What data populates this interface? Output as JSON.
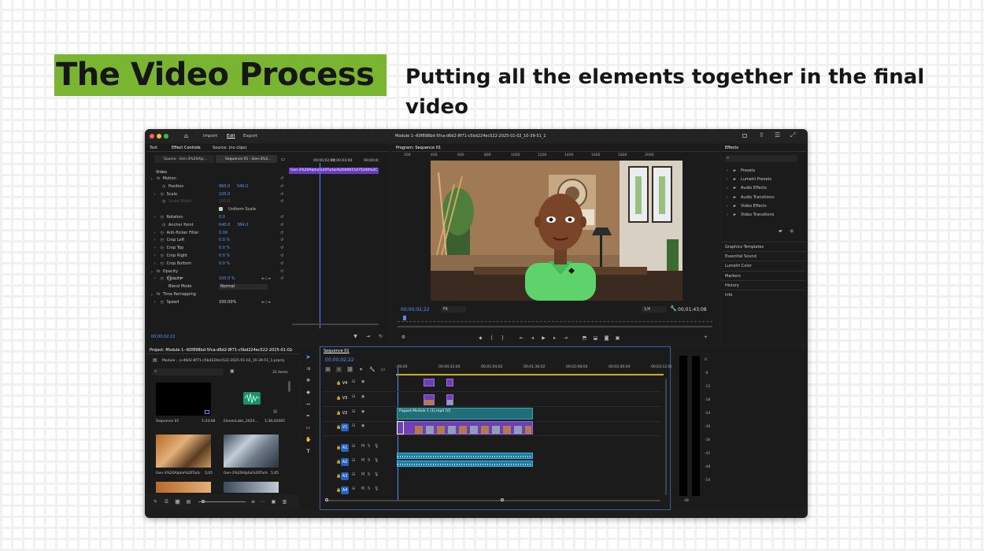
{
  "slide": {
    "title": "The Video Process",
    "subtitle": "Putting all the elements together in the final video",
    "accent_color": "#7ab532"
  },
  "app": {
    "top_tabs": [
      "Import",
      "Edit",
      "Export"
    ],
    "active_tab": "Edit",
    "window_title": "Module 1--60f898bd-5fca-d6d2-8f71-c5bd224ec522-2025-01-02_10-39-51_1"
  },
  "effect_controls": {
    "tabs": [
      "Text",
      "Effect Controls",
      "Source: (no clips)"
    ],
    "source_label": "Source · Gen-3%20Alp...",
    "sequence_label": "Sequence 01 · Gen-3%2...",
    "clip_name": "Gen-3%20Alpha%20Turbo%2040015475240%2C",
    "tc_ruler": [
      "00;00;02;00",
      "00;00;04;00",
      "00;00;0("
    ],
    "section": "Video",
    "rows": [
      {
        "label": "Motion",
        "v1": "",
        "v2": ""
      },
      {
        "label": "Position",
        "v1": "960.0",
        "v2": "540.0"
      },
      {
        "label": "Scale",
        "v1": "100.0",
        "v2": ""
      },
      {
        "label": "Scale Width",
        "v1": "100.0",
        "v2": ""
      },
      {
        "label": "Uniform Scale",
        "v1": "",
        "v2": ""
      },
      {
        "label": "Rotation",
        "v1": "0.0",
        "v2": ""
      },
      {
        "label": "Anchor Point",
        "v1": "640.0",
        "v2": "384.0"
      },
      {
        "label": "Anti-flicker Filter",
        "v1": "0.00",
        "v2": ""
      },
      {
        "label": "Crop Left",
        "v1": "0.0 %",
        "v2": ""
      },
      {
        "label": "Crop Top",
        "v1": "0.0 %",
        "v2": ""
      },
      {
        "label": "Crop Right",
        "v1": "0.0 %",
        "v2": ""
      },
      {
        "label": "Crop Bottom",
        "v1": "0.0 %",
        "v2": ""
      },
      {
        "label": "Opacity",
        "v1": "",
        "v2": ""
      },
      {
        "label": "Opacity",
        "v1": "100.0 %",
        "v2": ""
      },
      {
        "label": "Blend Mode",
        "v1": "Normal",
        "v2": ""
      },
      {
        "label": "Time Remapping",
        "v1": "",
        "v2": ""
      },
      {
        "label": "Speed",
        "v1": "100.00%",
        "v2": ""
      }
    ],
    "timecode": "00;00;02;22"
  },
  "program": {
    "title": "Program: Sequence 01",
    "ruler": [
      "200",
      "400",
      "600",
      "800",
      "1000",
      "1200",
      "1400",
      "1600",
      "1800",
      "2000"
    ],
    "timecode": "00;00;02;22",
    "fit": "Fit",
    "quality": "1/4",
    "duration": "00;01;43;08"
  },
  "effects": {
    "title": "Effects",
    "items": [
      "Presets",
      "Lumetri Presets",
      "Audio Effects",
      "Audio Transitions",
      "Video Effects",
      "Video Transitions"
    ],
    "panels": [
      "Graphics Templates",
      "Essential Sound",
      "Lumetri Color",
      "Markers",
      "History",
      "Info"
    ]
  },
  "project": {
    "title": "Project: Module 1--60f898bd-5fca-d6d2-8f71-c5bd224ec522-2025-01-02_10-3",
    "file": "Module ...a-d6d2-8f71-c5bd224ec522-2025-01-02_10-39-51_1.prproj",
    "count": "31 items",
    "items": [
      {
        "name": "Sequence 01",
        "dur": "1;43;08"
      },
      {
        "name": "ElevenLabs_2024...",
        "dur": "1;36;42065"
      },
      {
        "name": "Gen-3%20Alpha%20Turb...",
        "dur": "5;05"
      },
      {
        "name": "Gen-3%20Alpha%20Turb...",
        "dur": "5;05"
      }
    ]
  },
  "timeline": {
    "title": "Sequence 01",
    "timecode": "00;00;02;22",
    "ruler": [
      ":00;00",
      "00;00;32;00",
      "00;01;04;02",
      "00;01;36;02",
      "00;02;08;04",
      "00;02;40;04",
      "00;03;12;0("
    ],
    "video_tracks": [
      "V4",
      "V3",
      "V2",
      "V1"
    ],
    "audio_tracks": [
      "A1",
      "A2",
      "A3",
      "A4"
    ],
    "clip_label": "Puppet Module 1 (1).mp4 [V]"
  },
  "meter": {
    "scale": [
      "0",
      "-6",
      "-12",
      "-18",
      "-24",
      "-30",
      "-36",
      "-42",
      "-48",
      "-54",
      "dB"
    ]
  }
}
